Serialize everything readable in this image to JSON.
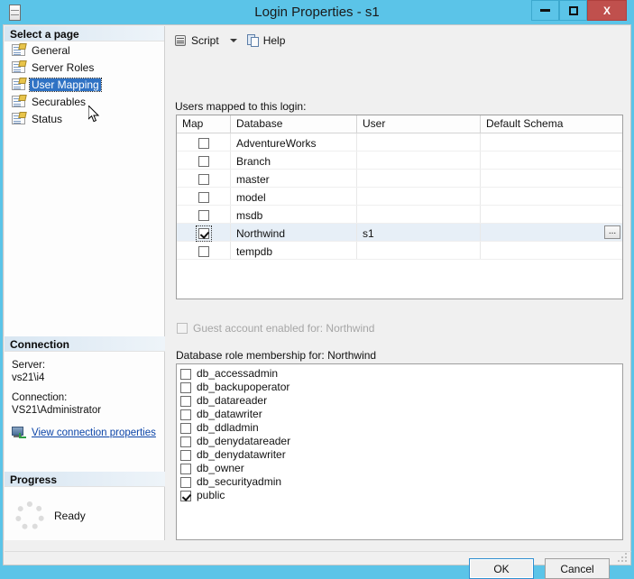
{
  "window": {
    "title": "Login Properties - s1",
    "icon": "server-icon",
    "buttons": {
      "minimize": "minimize-icon",
      "maximize": "maximize-icon",
      "close": "X"
    }
  },
  "toolbar": {
    "script_label": "Script",
    "script_icon": "script-icon",
    "dropdown_icon": "chevron-down-icon",
    "help_label": "Help",
    "help_icon": "help-icon"
  },
  "sidebar": {
    "heading": "Select a page",
    "items": [
      {
        "label": "General",
        "selected": false
      },
      {
        "label": "Server Roles",
        "selected": false
      },
      {
        "label": "User Mapping",
        "selected": true
      },
      {
        "label": "Securables",
        "selected": false
      },
      {
        "label": "Status",
        "selected": false
      }
    ],
    "connection": {
      "heading": "Connection",
      "server_label": "Server:",
      "server_value": "vs21\\i4",
      "connection_label": "Connection:",
      "connection_value": "VS21\\Administrator",
      "link": "View connection properties"
    },
    "progress": {
      "heading": "Progress",
      "status": "Ready"
    }
  },
  "main": {
    "users_label": "Users mapped to this login:",
    "columns": [
      "Map",
      "Database",
      "User",
      "Default Schema"
    ],
    "rows": [
      {
        "map": false,
        "database": "AdventureWorks",
        "user": "",
        "schema": "",
        "selected": false
      },
      {
        "map": false,
        "database": "Branch",
        "user": "",
        "schema": "",
        "selected": false
      },
      {
        "map": false,
        "database": "master",
        "user": "",
        "schema": "",
        "selected": false
      },
      {
        "map": false,
        "database": "model",
        "user": "",
        "schema": "",
        "selected": false
      },
      {
        "map": false,
        "database": "msdb",
        "user": "",
        "schema": "",
        "selected": false
      },
      {
        "map": true,
        "database": "Northwind",
        "user": "s1",
        "schema": "",
        "selected": true
      },
      {
        "map": false,
        "database": "tempdb",
        "user": "",
        "schema": "",
        "selected": false
      }
    ],
    "schema_browse_label": "...",
    "guest_account_label": "Guest account enabled for: Northwind",
    "guest_account_checked": false,
    "guest_account_enabled": false,
    "role_membership_label": "Database role membership for: Northwind",
    "roles": [
      {
        "label": "db_accessadmin",
        "checked": false
      },
      {
        "label": "db_backupoperator",
        "checked": false
      },
      {
        "label": "db_datareader",
        "checked": false
      },
      {
        "label": "db_datawriter",
        "checked": false
      },
      {
        "label": "db_ddladmin",
        "checked": false
      },
      {
        "label": "db_denydatareader",
        "checked": false
      },
      {
        "label": "db_denydatawriter",
        "checked": false
      },
      {
        "label": "db_owner",
        "checked": false
      },
      {
        "label": "db_securityadmin",
        "checked": false
      },
      {
        "label": "public",
        "checked": true
      }
    ]
  },
  "footer": {
    "ok_label": "OK",
    "cancel_label": "Cancel"
  },
  "colors": {
    "titlebar": "#5bc4e8",
    "close_button": "#c0504d",
    "selection": "#2f72c4",
    "row_selected": "#e7eff7",
    "link": "#0b44a8"
  }
}
